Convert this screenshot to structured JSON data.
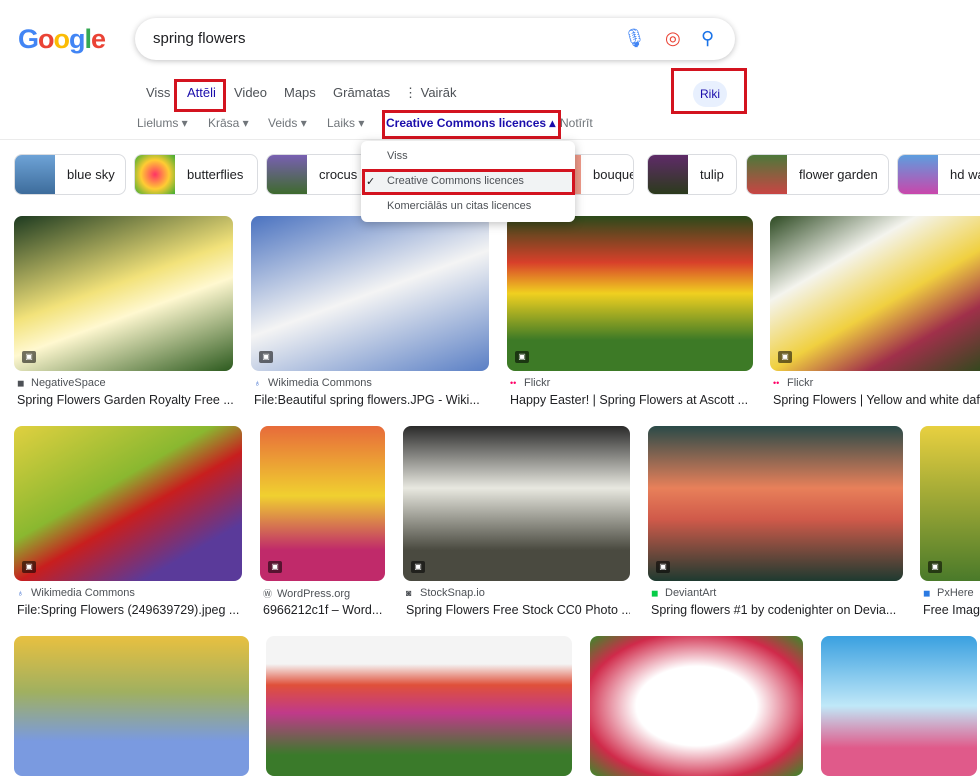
{
  "logo": "Google",
  "search": {
    "query": "spring flowers",
    "mic_icon": "mic-icon",
    "lens_icon": "camera-lens-icon",
    "search_icon": "search-icon"
  },
  "tabs": [
    "Viss",
    "Attēli",
    "Video",
    "Maps",
    "Grāmatas",
    "⋮ Vairāk"
  ],
  "active_tab": "Attēli",
  "filters": [
    "Lielums ▾",
    "Krāsa ▾",
    "Veids ▾",
    "Laiks ▾",
    "Creative Commons licences ▴",
    "Notīrīt"
  ],
  "safesearch_button": "Riki",
  "license_menu": {
    "items": [
      "Viss",
      "Creative Commons licences",
      "Komerciālās un citas licences"
    ],
    "selected": "Creative Commons licences"
  },
  "chips": [
    "blue sky",
    "butterflies",
    "crocus",
    "bouquets",
    "tulip",
    "flower garden",
    "hd wa"
  ],
  "results": [
    {
      "source": "NegativeSpace",
      "title": "Spring Flowers Garden Royalty Free ..."
    },
    {
      "source": "Wikimedia Commons",
      "title": "File:Beautiful spring flowers.JPG - Wiki..."
    },
    {
      "source": "Flickr",
      "title": "Happy Easter! | Spring Flowers at Ascott ..."
    },
    {
      "source": "Flickr",
      "title": "Spring Flowers | Yellow and white daf"
    },
    {
      "source": "Wikimedia Commons",
      "title": "File:Spring Flowers (249639729).jpeg ..."
    },
    {
      "source": "WordPress.org",
      "title": "6966212c1f – Word..."
    },
    {
      "source": "StockSnap.io",
      "title": "Spring Flowers Free Stock CC0 Photo ..."
    },
    {
      "source": "DeviantArt",
      "title": "Spring flowers #1 by codenighter on Devia..."
    },
    {
      "source": "PxHere",
      "title": "Free Imag"
    }
  ],
  "colors": {
    "accent": "#1a0dab",
    "highlight_box": "#d3131f"
  }
}
